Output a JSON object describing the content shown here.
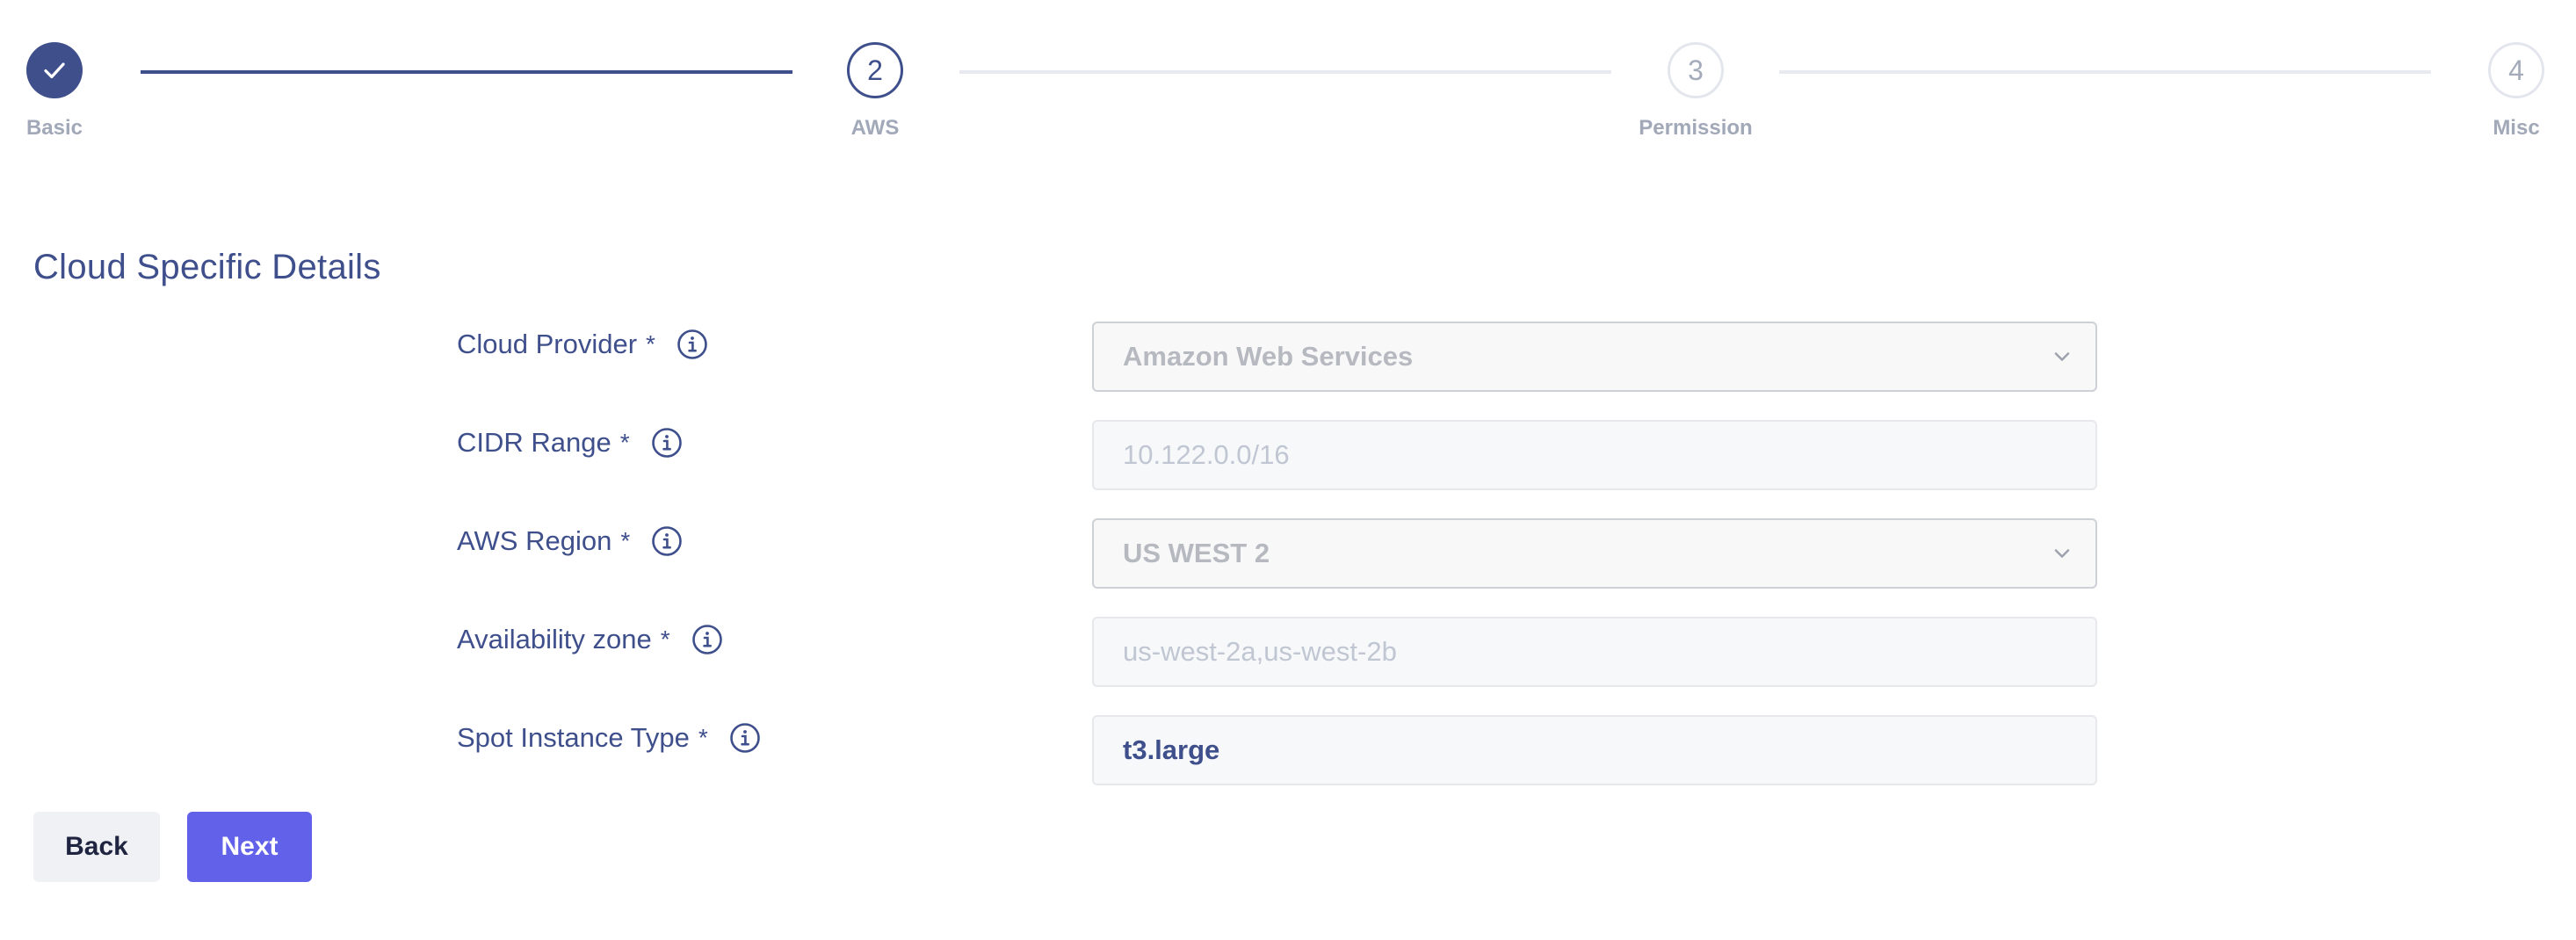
{
  "stepper": {
    "steps": [
      {
        "number": "1",
        "label": "Basic",
        "state": "completed",
        "icon": "check-icon"
      },
      {
        "number": "2",
        "label": "AWS",
        "state": "active"
      },
      {
        "number": "3",
        "label": "Permission",
        "state": "pending"
      },
      {
        "number": "4",
        "label": "Misc",
        "state": "pending"
      }
    ]
  },
  "section": {
    "title": "Cloud Specific Details"
  },
  "form": {
    "required_marker": "*",
    "info_icon": "info-icon",
    "fields": [
      {
        "label": "Cloud Provider",
        "type": "select",
        "value": "Amazon Web Services",
        "disabled": true,
        "icon": "chevron-down-icon"
      },
      {
        "label": "CIDR Range",
        "type": "input",
        "value": "10.122.0.0/16",
        "disabled": true
      },
      {
        "label": "AWS Region",
        "type": "select",
        "value": "US WEST 2",
        "disabled": true,
        "icon": "chevron-down-icon"
      },
      {
        "label": "Availability zone",
        "type": "input",
        "value": "us-west-2a,us-west-2b",
        "disabled": true
      },
      {
        "label": "Spot Instance Type",
        "type": "input",
        "value": "t3.large",
        "disabled": false
      }
    ]
  },
  "actions": {
    "back_label": "Back",
    "next_label": "Next"
  },
  "colors": {
    "primary": "#3e4f8c",
    "accent_button": "#6161ea",
    "muted_text": "#a1a8b8"
  }
}
